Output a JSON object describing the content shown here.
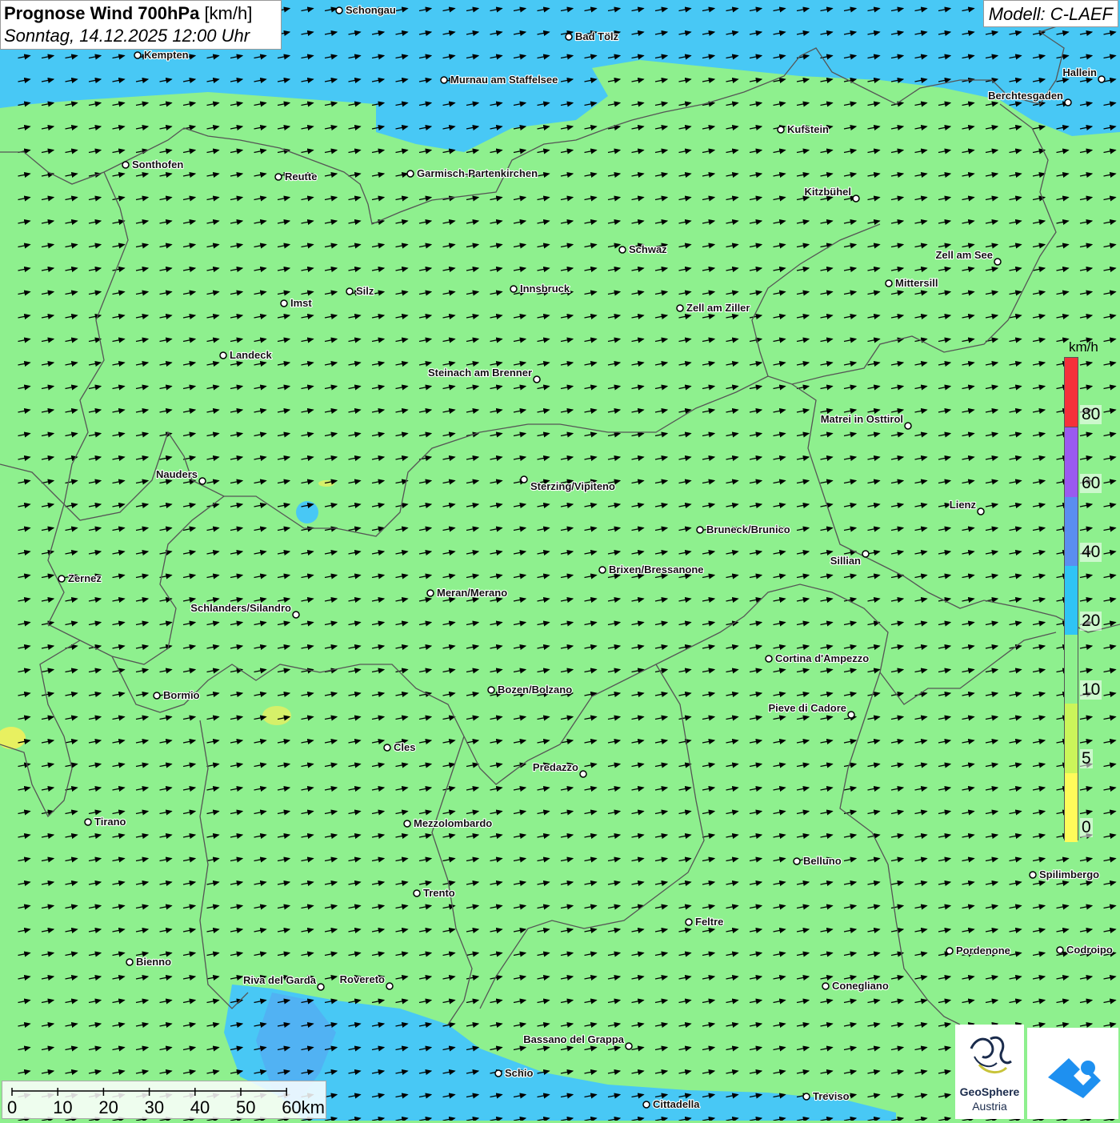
{
  "title": {
    "main": "Prognose Wind 700hPa",
    "unit": "[km/h]",
    "datetime": "Sonntag, 14.12.2025 12:00 Uhr"
  },
  "model": "Modell: C-LAEF",
  "legend": {
    "unit": "km/h",
    "ticks": [
      {
        "label": "80",
        "value": 80
      },
      {
        "label": "60",
        "value": 60
      },
      {
        "label": "40",
        "value": 40
      },
      {
        "label": "20",
        "value": 20
      },
      {
        "label": "10",
        "value": 10
      },
      {
        "label": "5",
        "value": 5
      },
      {
        "label": "0",
        "value": 0
      }
    ],
    "colors": [
      "#fffb5a",
      "#cbf55a",
      "#8ef08e",
      "#2fc4f5",
      "#5a8ef0",
      "#9a5af0",
      "#f5303a"
    ]
  },
  "colors": {
    "calm_wind": "#8ef08e",
    "moderate_wind": "#44c8f5",
    "strong_wind": "#5a9af0",
    "light_wind": "#e8f060",
    "border": "#555555",
    "arrow": "#000000"
  },
  "scale_bar": {
    "labels": [
      "0",
      "10",
      "20",
      "30",
      "40",
      "50",
      "60km"
    ]
  },
  "wind": {
    "prevailing_direction": "west-southwest"
  },
  "cities": [
    {
      "name": "Schongau"
    },
    {
      "name": "Bad Tölz"
    },
    {
      "name": "Kempten"
    },
    {
      "name": "Murnau am Staffelsee"
    },
    {
      "name": "Hallein"
    },
    {
      "name": "Berchtesgaden"
    },
    {
      "name": "Kufstein"
    },
    {
      "name": "Sonthofen"
    },
    {
      "name": "Reutte"
    },
    {
      "name": "Garmisch-Partenkirchen"
    },
    {
      "name": "Kitzbühel"
    },
    {
      "name": "Schwaz"
    },
    {
      "name": "Zell am See"
    },
    {
      "name": "Mittersill"
    },
    {
      "name": "Innsbruck"
    },
    {
      "name": "Silz"
    },
    {
      "name": "Imst"
    },
    {
      "name": "Zell am Ziller"
    },
    {
      "name": "Landeck"
    },
    {
      "name": "Steinach am Brenner"
    },
    {
      "name": "Matrei in Osttirol"
    },
    {
      "name": "Nauders"
    },
    {
      "name": "Sterzing/Vipiteno"
    },
    {
      "name": "Lienz"
    },
    {
      "name": "Bruneck/Brunico"
    },
    {
      "name": "Sillian"
    },
    {
      "name": "Zernez"
    },
    {
      "name": "Brixen/Bressanone"
    },
    {
      "name": "Meran/Merano"
    },
    {
      "name": "Schlanders/Silandro"
    },
    {
      "name": "Cortina d'Ampezzo"
    },
    {
      "name": "Bormio"
    },
    {
      "name": "Bozen/Bolzano"
    },
    {
      "name": "Pieve di Cadore"
    },
    {
      "name": "Cles"
    },
    {
      "name": "Predazzo"
    },
    {
      "name": "Tirano"
    },
    {
      "name": "Mezzolombardo"
    },
    {
      "name": "Belluno"
    },
    {
      "name": "Spilimbergo"
    },
    {
      "name": "Trento"
    },
    {
      "name": "Feltre"
    },
    {
      "name": "Pordenone"
    },
    {
      "name": "Codroipo"
    },
    {
      "name": "Bienno"
    },
    {
      "name": "Riva del Garda"
    },
    {
      "name": "Rovereto"
    },
    {
      "name": "Conegliano"
    },
    {
      "name": "Bassano del Grappa"
    },
    {
      "name": "Schio"
    },
    {
      "name": "Cittadella"
    },
    {
      "name": "Treviso"
    }
  ],
  "logos": {
    "geosphere_line1": "GeoSphere",
    "geosphere_line2": "Austria"
  }
}
